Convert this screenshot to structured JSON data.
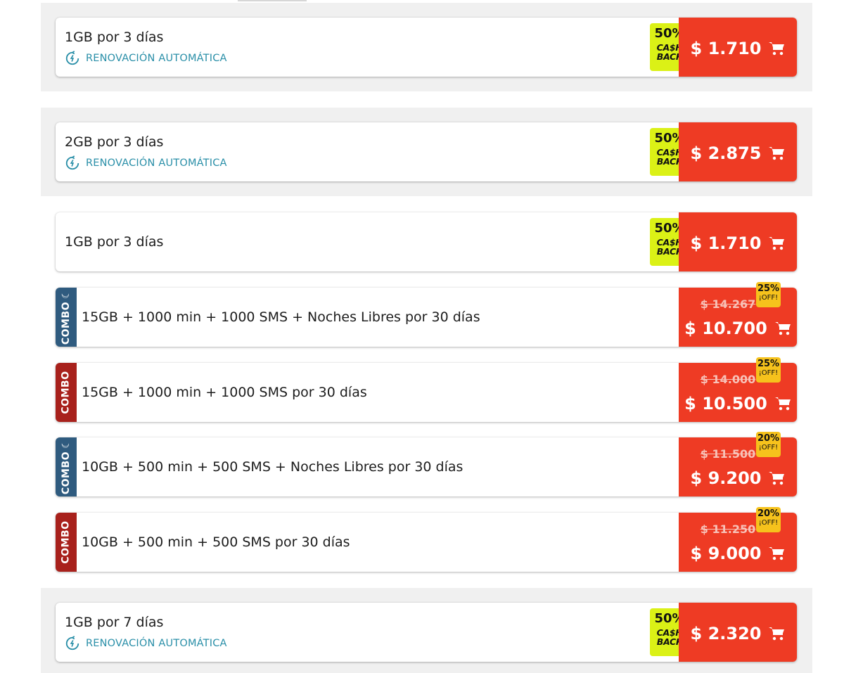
{
  "plans": [
    {
      "title": "1GB por 3 días",
      "renewal": "RENOVACIÓN AUTOMÁTICA",
      "cashback_pct": "50%",
      "cashback_label_1": "CA$H",
      "cashback_label_2": "BACK",
      "price": "$ 1.710"
    },
    {
      "title": "2GB por 3 días",
      "renewal": "RENOVACIÓN AUTOMÁTICA",
      "cashback_pct": "50%",
      "cashback_label_1": "CA$H",
      "cashback_label_2": "BACK",
      "price": "$ 2.875"
    },
    {
      "title": "1GB por 3 días",
      "cashback_pct": "50%",
      "cashback_label_1": "CA$H",
      "cashback_label_2": "BACK",
      "price": "$ 1.710"
    },
    {
      "title": "1GB por 7 días",
      "renewal": "RENOVACIÓN AUTOMÁTICA",
      "cashback_pct": "50%",
      "cashback_label_1": "CA$H",
      "cashback_label_2": "BACK",
      "price": "$ 2.320"
    }
  ],
  "combos": [
    {
      "badge": "COMBO",
      "color": "#2f5b7f",
      "moon": true,
      "title": "15GB + 1000 min + 1000 SMS + Noches Libres por 30 días",
      "old_price": "$ 14.267",
      "price": "$ 10.700",
      "discount": "25%",
      "discount_label": "¡OFF!"
    },
    {
      "badge": "COMBO",
      "color": "#a8211c",
      "moon": false,
      "title": "15GB + 1000 min + 1000 SMS por 30 días",
      "old_price": "$ 14.000",
      "price": "$ 10.500",
      "discount": "25%",
      "discount_label": "¡OFF!"
    },
    {
      "badge": "COMBO",
      "color": "#2f5b7f",
      "moon": true,
      "title": "10GB + 500 min + 500 SMS + Noches Libres por 30 días",
      "old_price": "$ 11.500",
      "price": "$ 9.200",
      "discount": "20%",
      "discount_label": "¡OFF!"
    },
    {
      "badge": "COMBO",
      "color": "#a8211c",
      "moon": false,
      "title": "10GB + 500 min + 500 SMS por 30 días",
      "old_price": "$ 11.250",
      "price": "$ 9.000",
      "discount": "20%",
      "discount_label": "¡OFF!"
    }
  ],
  "icons": {
    "renewal": "renewal-icon",
    "cart": "cart-icon",
    "moon": "moon-icon"
  },
  "colors": {
    "price_bg": "#ee3b24",
    "cashback_bg": "#dbf116",
    "discount_bg": "#f6c21c",
    "renewal_text": "#2a8fa8"
  }
}
